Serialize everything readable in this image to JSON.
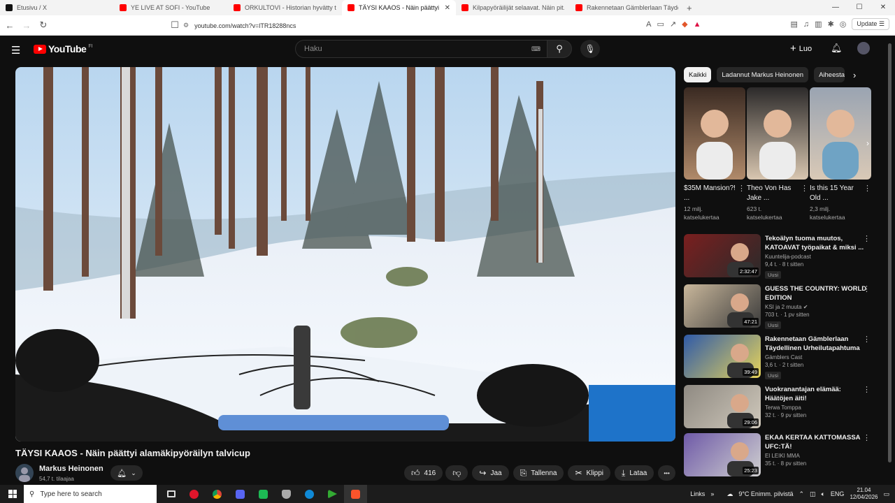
{
  "browser": {
    "tabs": [
      {
        "label": "Etusivu / X",
        "fav_color": "#111111",
        "active": false
      },
      {
        "label": "YE LIVE AT SOFI - YouTube",
        "fav_color": "#ff0000",
        "active": false
      },
      {
        "label": "ORKULTOVI - Historian hyvätty toisto",
        "fav_color": "#ff0000",
        "active": false
      },
      {
        "label": "TÄYSI KAAOS - Näin päättyi alamäkipyöräilyn...",
        "fav_color": "#ff0000",
        "active": true
      },
      {
        "label": "Kilpapyöräilijät selaavat. Näin pit...",
        "fav_color": "#ff0000",
        "active": false
      },
      {
        "label": "Rakennetaan Gämblerlaan Täydellinen",
        "fav_color": "#ff0000",
        "active": false
      }
    ],
    "new_tab": "+",
    "tab_close": "✕",
    "url": "youtube.com/watch?v=lTR18288ncs",
    "update_label": "Update",
    "minimize": "—",
    "maximize": "☐",
    "close": "✕"
  },
  "header": {
    "logo_text": "YouTube",
    "country_code": "FI",
    "search_placeholder": "Haku",
    "create_label": "Luo"
  },
  "video": {
    "title": "TÄYSI KAAOS - Näin päättyi alamäkipyöräilyn talvicup",
    "channel_name": "Markus Heinonen",
    "subscribers": "54,7 t. tilaajaa",
    "likes": "416",
    "share_label": "Jaa",
    "save_label": "Tallenna",
    "clip_label": "Klippi",
    "download_label": "Lataa",
    "more_label": "•••"
  },
  "chips": [
    "Kaikki",
    "Ladannut Markus Heinonen",
    "Aiheesta"
  ],
  "shorts": [
    {
      "title": "$35M Mansion?! ...",
      "views_line1": "12 milj.",
      "views_line2": "katselukertaa"
    },
    {
      "title": "Theo Von Has Jake ...",
      "views_line1": "623 t.",
      "views_line2": "katselukertaa"
    },
    {
      "title": "Is this 15 Year Old ...",
      "views_line1": "2,3 milj.",
      "views_line2": "katselukertaa"
    }
  ],
  "recommendations": [
    {
      "title": "Tekoälyn tuoma muutos, KATOAVAT työpaikat & miksi ...",
      "channel": "Kuuntelija-podcast",
      "meta": "9,4 t. · 8 t sitten",
      "duration": "2:32:47",
      "new": "Uusi"
    },
    {
      "title": "GUESS THE COUNTRY: WORLD EDITION",
      "channel": "KSI ja 2 muuta ✔",
      "meta": "703 t. · 1 pv sitten",
      "duration": "47:21",
      "new": "Uusi"
    },
    {
      "title": "Rakennetaan Gämblerlaan Täydellinen Urheilutapahtuma",
      "channel": "Gämblers Cast",
      "meta": "3,6 t. · 2 t sitten",
      "duration": "39:49",
      "new": "Uusi"
    },
    {
      "title": "Vuokranantajan elämää: Häätöjen äiti!",
      "channel": "Terwa Tomppa",
      "meta": "32 t. · 9 pv sitten",
      "duration": "29:06",
      "new": ""
    },
    {
      "title": "EKAA KERTAA KATTOMASSA UFC:TÄ!",
      "channel": "El LEIKI MMA",
      "meta": "35 t. · 8 pv sitten",
      "duration": "25:23",
      "new": ""
    }
  ],
  "taskbar": {
    "search_placeholder": "Type here to search",
    "links_label": "Links",
    "weather": "9°C  Enimm. pilvistä",
    "language": "ENG",
    "time": "21.04",
    "date": "12/04/2026"
  }
}
